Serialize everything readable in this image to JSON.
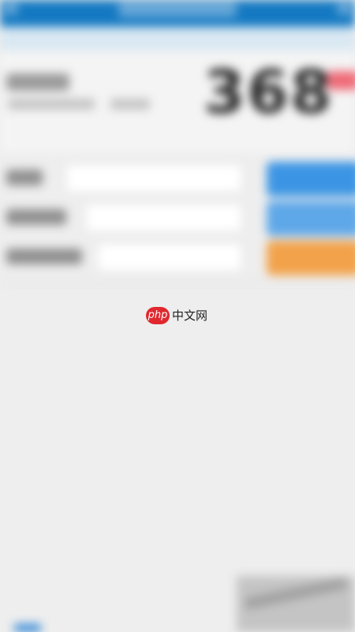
{
  "header": {
    "score_value": "368"
  },
  "form": {
    "rows": [
      {
        "label": "",
        "value": ""
      },
      {
        "label": "",
        "value": ""
      },
      {
        "label": "",
        "value": ""
      }
    ]
  },
  "watermark": {
    "logo_text": "php",
    "site_text": "中文网"
  },
  "colors": {
    "status_bar": "#1479c2",
    "primary_button": "#3c95e4",
    "secondary_button": "#5ea7e8",
    "warning_button": "#f2a24a",
    "badge": "#ef6b78",
    "watermark_red": "#e0282f"
  }
}
